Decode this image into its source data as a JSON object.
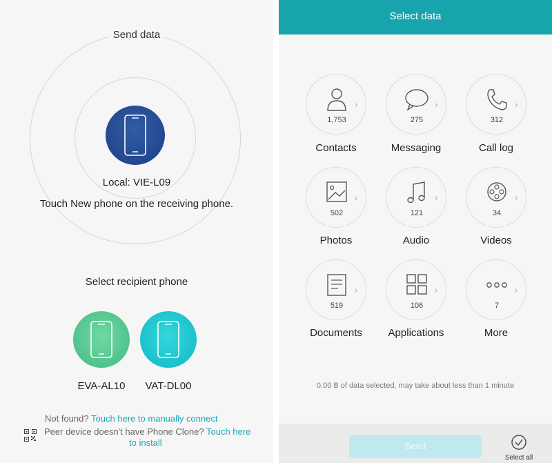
{
  "send_panel": {
    "title": "Send data",
    "local_device": "Local: VIE-L09",
    "touch_hint": "Touch New phone on the receiving phone.",
    "recipient_title": "Select recipient phone",
    "recipients": [
      {
        "name": "EVA-AL10",
        "color": "#40bb82"
      },
      {
        "name": "VAT-DL00",
        "color": "#12b8c4"
      }
    ],
    "not_found_prefix": "Not found?",
    "not_found_link": "Touch here to manually connect",
    "peer_prefix": "Peer device doesn't have Phone Clone?",
    "peer_link_1": "Touch here",
    "peer_link_2": "to install"
  },
  "select_panel": {
    "title": "Select data",
    "accent": "#17a4ad",
    "items": [
      {
        "label": "Contacts",
        "count": "1,753",
        "icon": "contact-icon"
      },
      {
        "label": "Messaging",
        "count": "275",
        "icon": "message-icon"
      },
      {
        "label": "Call log",
        "count": "312",
        "icon": "phone-icon"
      },
      {
        "label": "Photos",
        "count": "502",
        "icon": "photo-icon"
      },
      {
        "label": "Audio",
        "count": "121",
        "icon": "music-icon"
      },
      {
        "label": "Videos",
        "count": "34",
        "icon": "film-reel-icon"
      },
      {
        "label": "Documents",
        "count": "519",
        "icon": "document-icon"
      },
      {
        "label": "Applications",
        "count": "106",
        "icon": "apps-grid-icon"
      },
      {
        "label": "More",
        "count": "7",
        "icon": "more-dots-icon"
      }
    ],
    "summary": "0.00 B of data selected, may take about less than 1 minute",
    "send_label": "Send",
    "select_all_label": "Select all"
  }
}
